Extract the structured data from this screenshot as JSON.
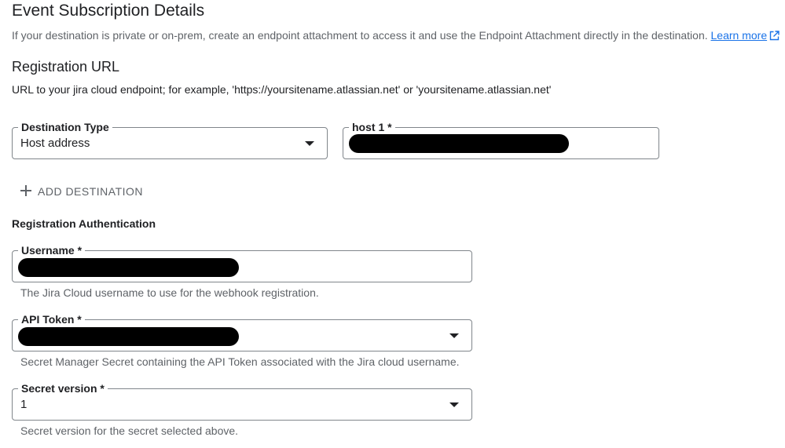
{
  "header": {
    "title": "Event Subscription Details",
    "description": "If your destination is private or on-prem, create an endpoint attachment to access it and use the Endpoint Attachment directly in the destination.",
    "learn_more": "Learn more",
    "learn_more_icon": "external-link-icon"
  },
  "registration_url": {
    "title": "Registration URL",
    "description": "URL to your jira cloud endpoint; for example, 'https://yoursitename.atlassian.net' or 'yoursitename.atlassian.net'"
  },
  "destination": {
    "type_label": "Destination Type",
    "type_value": "Host address",
    "host_label": "host 1 *",
    "add_label": "ADD DESTINATION",
    "add_icon": "plus-icon"
  },
  "auth": {
    "title": "Registration Authentication",
    "username_label": "Username *",
    "username_helper": "The Jira Cloud username to use for the webhook registration.",
    "api_token_label": "API Token *",
    "api_token_helper": "Secret Manager Secret containing the API Token associated with the Jira cloud username.",
    "secret_version_label": "Secret version *",
    "secret_version_value": "1",
    "secret_version_helper": "Secret version for the secret selected above."
  },
  "colors": {
    "link": "#1a73e8",
    "border": "#80868b",
    "text_primary": "#202124",
    "text_secondary": "#5f6368",
    "redaction": "#000000"
  }
}
